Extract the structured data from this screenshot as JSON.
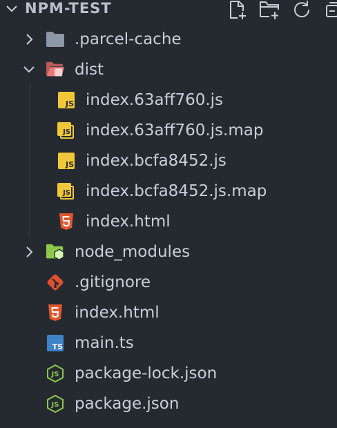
{
  "explorer": {
    "section_title": "NPM-TEST",
    "actions": [
      {
        "name": "new-file-icon"
      },
      {
        "name": "new-folder-icon"
      },
      {
        "name": "refresh-icon"
      },
      {
        "name": "collapse-all-icon"
      }
    ]
  },
  "tree": {
    "items": [
      {
        "label": ".parcel-cache",
        "icon": "folder-icon",
        "expanded": false
      },
      {
        "label": "dist",
        "icon": "folder-open-icon",
        "expanded": true
      },
      {
        "label": "index.63aff760.js",
        "icon": "javascript-file-icon"
      },
      {
        "label": "index.63aff760.js.map",
        "icon": "javascript-map-file-icon"
      },
      {
        "label": "index.bcfa8452.js",
        "icon": "javascript-file-icon"
      },
      {
        "label": "index.bcfa8452.js.map",
        "icon": "javascript-map-file-icon"
      },
      {
        "label": "index.html",
        "icon": "html5-file-icon"
      },
      {
        "label": "node_modules",
        "icon": "node-folder-icon",
        "expanded": false
      },
      {
        "label": ".gitignore",
        "icon": "git-icon"
      },
      {
        "label": "index.html",
        "icon": "html5-file-icon"
      },
      {
        "label": "main.ts",
        "icon": "typescript-file-icon"
      },
      {
        "label": "package-lock.json",
        "icon": "nodejs-icon"
      },
      {
        "label": "package.json",
        "icon": "nodejs-icon"
      }
    ]
  },
  "badges": {
    "js": "JS",
    "ts": "TS"
  },
  "colors": {
    "background": "#252a31",
    "text": "#c9cfd8",
    "js_yellow": "#f0c738",
    "html_orange": "#e4572e",
    "ts_blue": "#3e82c8",
    "node_green": "#8cc84b",
    "folder_grey": "#8d97a5",
    "dist_folder": "#e87878",
    "git_orange": "#e0502f"
  }
}
